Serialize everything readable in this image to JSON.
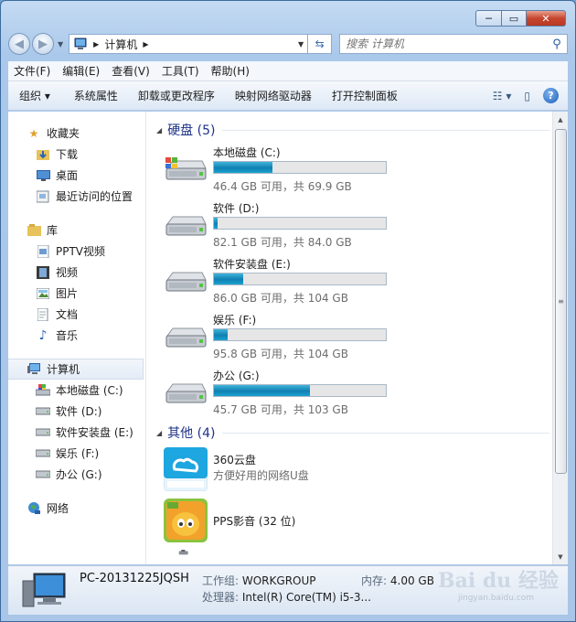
{
  "window": {
    "caption": {
      "minimize": "─",
      "maximize": "▭",
      "close": "✕"
    }
  },
  "address_bar": {
    "path": "计算机",
    "search_placeholder": "搜索 计算机"
  },
  "menu": [
    "文件(F)",
    "编辑(E)",
    "查看(V)",
    "工具(T)",
    "帮助(H)"
  ],
  "toolbar": {
    "organize": "组织 ▾",
    "items": [
      "系统属性",
      "卸载或更改程序",
      "映射网络驱动器",
      "打开控制面板"
    ],
    "help": "?"
  },
  "sidebar": {
    "favorites": {
      "label": "收藏夹",
      "items": [
        "下载",
        "桌面",
        "最近访问的位置"
      ]
    },
    "libraries": {
      "label": "库",
      "items": [
        "PPTV视频",
        "视频",
        "图片",
        "文档",
        "音乐"
      ]
    },
    "computer": {
      "label": "计算机",
      "items": [
        "本地磁盘 (C:)",
        "软件 (D:)",
        "软件安装盘 (E:)",
        "娱乐 (F:)",
        "办公 (G:)"
      ]
    },
    "network": {
      "label": "网络"
    }
  },
  "main": {
    "hard_disks": {
      "header": "硬盘 (5)",
      "drives": [
        {
          "name": "本地磁盘 (C:)",
          "free": "46.4 GB 可用，共 69.9 GB",
          "used_fraction": 0.34
        },
        {
          "name": "软件 (D:)",
          "free": "82.1 GB 可用，共 84.0 GB",
          "used_fraction": 0.02
        },
        {
          "name": "软件安装盘 (E:)",
          "free": "86.0 GB 可用，共 104 GB",
          "used_fraction": 0.17
        },
        {
          "name": "娱乐 (F:)",
          "free": "95.8 GB 可用，共 104 GB",
          "used_fraction": 0.08
        },
        {
          "name": "办公 (G:)",
          "free": "45.7 GB 可用，共 103 GB",
          "used_fraction": 0.56
        }
      ]
    },
    "others": {
      "header": "其他 (4)",
      "items": [
        {
          "name": "360云盘",
          "desc": "方便好用的网络U盘"
        },
        {
          "name": "PPS影音 (32 位)",
          "desc": ""
        }
      ]
    }
  },
  "details": {
    "pc_name": "PC-20131225JQSH",
    "workgroup_label": "工作组:",
    "workgroup": "WORKGROUP",
    "memory_label": "内存:",
    "memory": "4.00 GB",
    "cpu_label": "处理器:",
    "cpu": "Intel(R) Core(TM) i5-3..."
  },
  "watermark": {
    "logo": "Bai du 经验",
    "url": "jingyan.baidu.com"
  },
  "colors": {
    "accent": "#1e3287",
    "bar_fill": "#1a8fc2",
    "titlebar": "#b3cdea"
  }
}
